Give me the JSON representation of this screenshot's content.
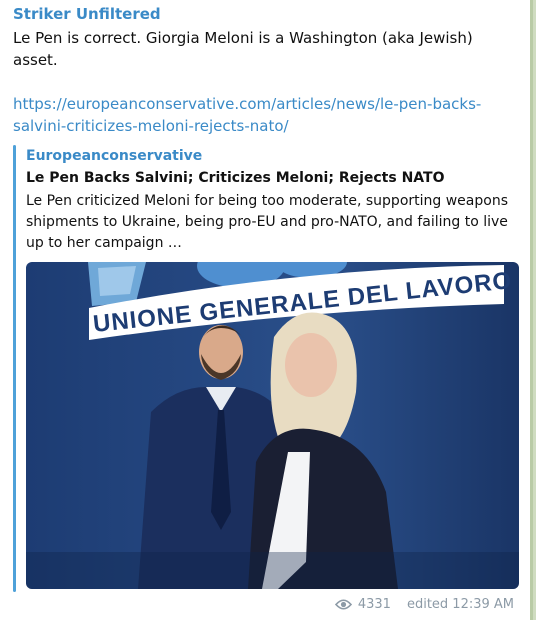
{
  "message": {
    "sender": "Striker Unfiltered",
    "text": "Le Pen is correct. Giorgia Meloni is a Washington (aka Jewish) asset.",
    "link": "https://europeanconservative.com/articles/news/le-pen-backs-salvini-criticizes-meloni-rejects-nato/"
  },
  "preview": {
    "site_name": "Europeanconservative",
    "title": "Le Pen Backs Salvini; Criticizes Meloni; Rejects NATO",
    "description": "Le Pen criticized Meloni for being too moderate, supporting weapons shipments to Ukraine, being pro-EU and pro-NATO, and failing to live up to her campaign …",
    "image_banner_text": "UNIONE GENERALE DEL LAVORO"
  },
  "meta": {
    "views": "4331",
    "status": "edited 12:39 AM",
    "view_icon": "eye-icon"
  },
  "colors": {
    "accent": "#3a8ac7",
    "preview_bar": "#4ea1d9",
    "meta_text": "#8c9aa6",
    "chat_background": "#cfdcc0"
  }
}
